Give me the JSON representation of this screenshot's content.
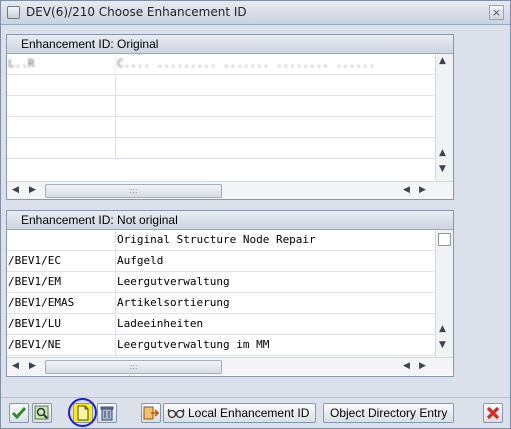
{
  "window": {
    "title": "DEV(6)/210 Choose Enhancement ID",
    "close_label": "×"
  },
  "panel_original": {
    "header": "Enhancement ID: Original",
    "rows": [
      {
        "id": "L..R",
        "desc": "C.... ......... ....... ........ ......"
      }
    ]
  },
  "panel_not_original": {
    "header": "Enhancement ID: Not original",
    "rows": [
      {
        "id": "",
        "desc": "Original Structure Node Repair"
      },
      {
        "id": "/BEV1/EC",
        "desc": "Aufgeld"
      },
      {
        "id": "/BEV1/EM",
        "desc": "Leergutverwaltung"
      },
      {
        "id": "/BEV1/EMAS",
        "desc": "Artikelsortierung"
      },
      {
        "id": "/BEV1/LU",
        "desc": "Ladeeinheiten"
      },
      {
        "id": "/BEV1/NE",
        "desc": "Leergutverwaltung im MM"
      }
    ]
  },
  "toolbar": {
    "local_enh_label": "Local Enhancement ID",
    "obj_dir_label": "Object Directory Entry"
  },
  "colors": {
    "confirm": "#2e8b2e",
    "highlight_circle": "#1b1fdb",
    "create_icon_fill": "#ffee00",
    "cancel": "#d42a1b"
  }
}
